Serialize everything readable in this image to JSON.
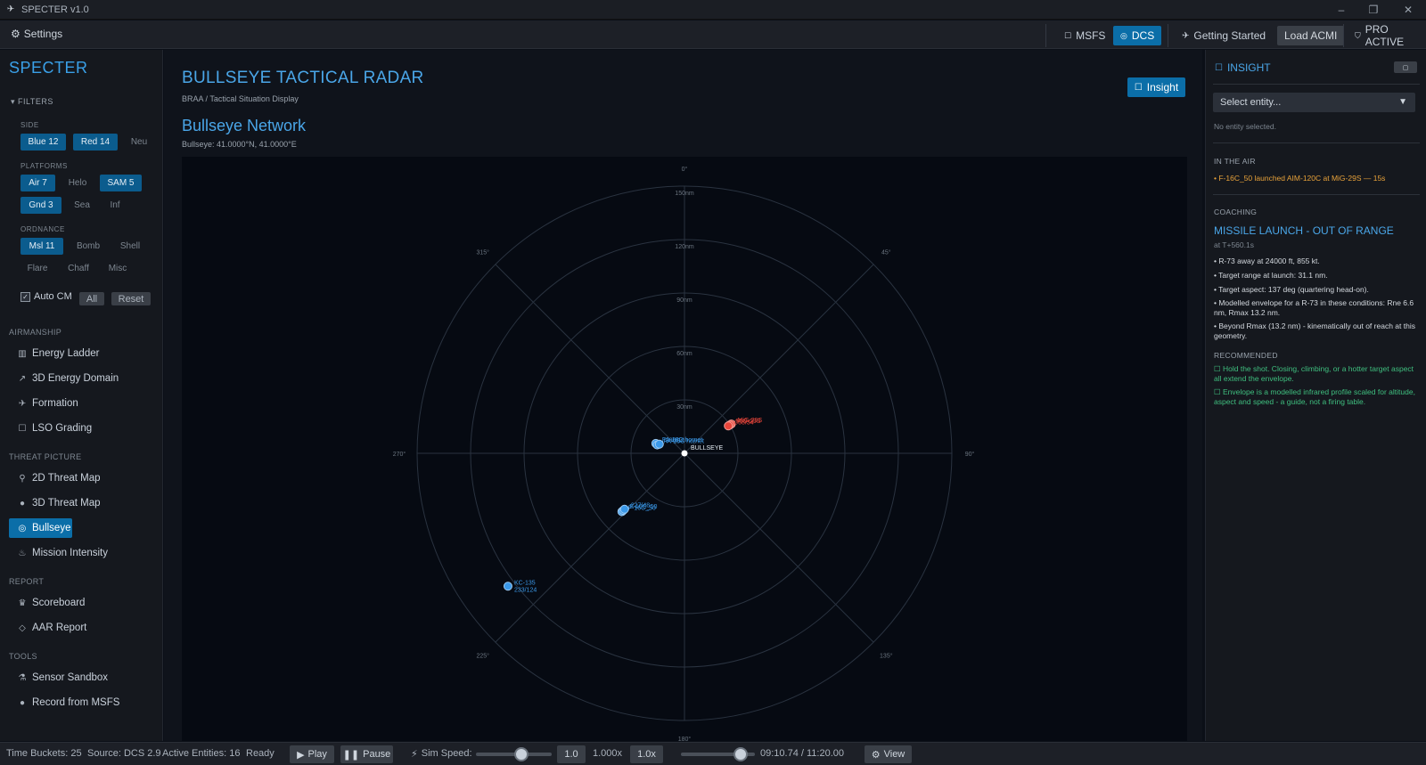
{
  "window": {
    "title": "SPECTER v1.0",
    "minimize": "–",
    "restore": "❐",
    "close": "✕"
  },
  "menubar": {
    "settings": "Settings",
    "sim_msfs": "MSFS",
    "sim_dcs": "DCS",
    "getting_started": "Getting Started",
    "load_acmi": "Load ACMI",
    "pro_active": "PRO ACTIVE"
  },
  "sidebar": {
    "brand": "SPECTER",
    "filters_header": "FILTERS",
    "side_label": "SIDE",
    "side": [
      "Blue 12",
      "Red 14",
      "Neu"
    ],
    "platforms_label": "PLATFORMS",
    "platforms": [
      "Air 7",
      "Helo",
      "SAM 5",
      "Gnd 3",
      "Sea",
      "Inf"
    ],
    "ordnance_label": "ORDNANCE",
    "ordnance": [
      "Msl 11",
      "Bomb",
      "Shell",
      "Flare",
      "Chaff",
      "Misc"
    ],
    "auto_cm": "Auto CM",
    "all": "All",
    "reset": "Reset",
    "sections": {
      "airmanship": "AIRMANSHIP",
      "threat": "THREAT PICTURE",
      "report": "REPORT",
      "tools": "TOOLS"
    },
    "nav": {
      "energy_ladder": "Energy Ladder",
      "energy_domain": "3D Energy Domain",
      "formation": "Formation",
      "lso": "LSO Grading",
      "threat2d": "2D Threat Map",
      "threat3d": "3D Threat Map",
      "bullseye": "Bullseye",
      "intensity": "Mission Intensity",
      "scoreboard": "Scoreboard",
      "aar": "AAR Report",
      "sandbox": "Sensor Sandbox",
      "record": "Record from MSFS"
    }
  },
  "main": {
    "title": "BULLSEYE TACTICAL RADAR",
    "subtitle": "BRAA / Tactical Situation Display",
    "insight_button": "Insight",
    "network_title": "Bullseye Network",
    "network_sub": "Bullseye: 41.0000°N, 41.0000°E"
  },
  "radar": {
    "range_rings_nm": [
      30,
      60,
      90,
      120,
      150
    ],
    "ring_labels": [
      "30nm",
      "60nm",
      "90nm",
      "120nm",
      "150nm"
    ],
    "bearing_labels": [
      {
        "deg": 0,
        "text": "0°"
      },
      {
        "deg": 45,
        "text": "45°"
      },
      {
        "deg": 90,
        "text": "90°"
      },
      {
        "deg": 135,
        "text": "135°"
      },
      {
        "deg": 180,
        "text": "180°"
      },
      {
        "deg": 225,
        "text": "225°"
      },
      {
        "deg": 270,
        "text": "270°"
      },
      {
        "deg": 315,
        "text": "315°"
      }
    ],
    "center_label": "BULLSEYE",
    "contacts": [
      {
        "side": "blue",
        "brg": 289,
        "rng": 17,
        "label": "FA-18C hornet"
      },
      {
        "side": "blue",
        "brg": 287,
        "rng": 16,
        "label": "FA-18C hornet"
      },
      {
        "side": "blue",
        "brg": 290,
        "rng": 15,
        "label": "290/14"
      },
      {
        "side": "blue",
        "brg": 227,
        "rng": 48,
        "label": "F-16C_50"
      },
      {
        "side": "blue",
        "brg": 227,
        "rng": 47,
        "label": "F-16C_50"
      },
      {
        "side": "blue",
        "brg": 227,
        "rng": 46,
        "label": "227/48"
      },
      {
        "side": "blue",
        "brg": 233,
        "rng": 124,
        "label": "KC-135",
        "sublabel": "233/124"
      },
      {
        "side": "red",
        "brg": 58,
        "rng": 31,
        "label": "MiG-29S"
      },
      {
        "side": "red",
        "brg": 58,
        "rng": 30,
        "label": "MiG-29S"
      },
      {
        "side": "red",
        "brg": 58,
        "rng": 29,
        "label": "058/34"
      }
    ],
    "colors": {
      "blue": "#3a98e8",
      "red": "#e8453a",
      "grid": "#2a3340"
    }
  },
  "insight": {
    "header": "INSIGHT",
    "close": "▢",
    "select_placeholder": "Select entity...",
    "no_entity": "No entity selected.",
    "in_the_air": "IN THE AIR",
    "in_the_air_item": "• F-16C_50 launched AIM-120C at MiG-29S — 15s",
    "coaching": "COACHING",
    "coach_title": "MISSILE LAUNCH - OUT OF RANGE",
    "coach_time": "at T+560.1s",
    "bullets": [
      "• R-73 away at 24000 ft, 855 kt.",
      "• Target range at launch: 31.1 nm.",
      "• Target aspect: 137 deg (quartering head-on).",
      "• Modelled envelope for a R-73 in these conditions: Rne 6.6 nm, Rmax 13.2 nm.",
      "• Beyond Rmax (13.2 nm) - kinematically out of reach at this geometry."
    ],
    "recommended": "RECOMMENDED",
    "recs": [
      "Hold the shot. Closing, climbing, or a hotter target aspect all extend the envelope.",
      "Envelope is a modelled infrared profile scaled for altitude, aspect and speed - a guide, not a firing table."
    ]
  },
  "statusbar": {
    "time_buckets": "Time Buckets: 25",
    "source": "Source: DCS 2.9",
    "entities": "Active Entities: 16",
    "ready": "Ready",
    "play": "Play",
    "pause": "Pause",
    "sim_speed": "Sim Speed:",
    "speed_value": "1.0",
    "speed_mult": "1.000x",
    "speed_btn": "1.0x",
    "time": "09:10.74 / 11:20.00",
    "view": "View",
    "sim_speed_level": 0.6,
    "timeline_level": 0.81
  }
}
